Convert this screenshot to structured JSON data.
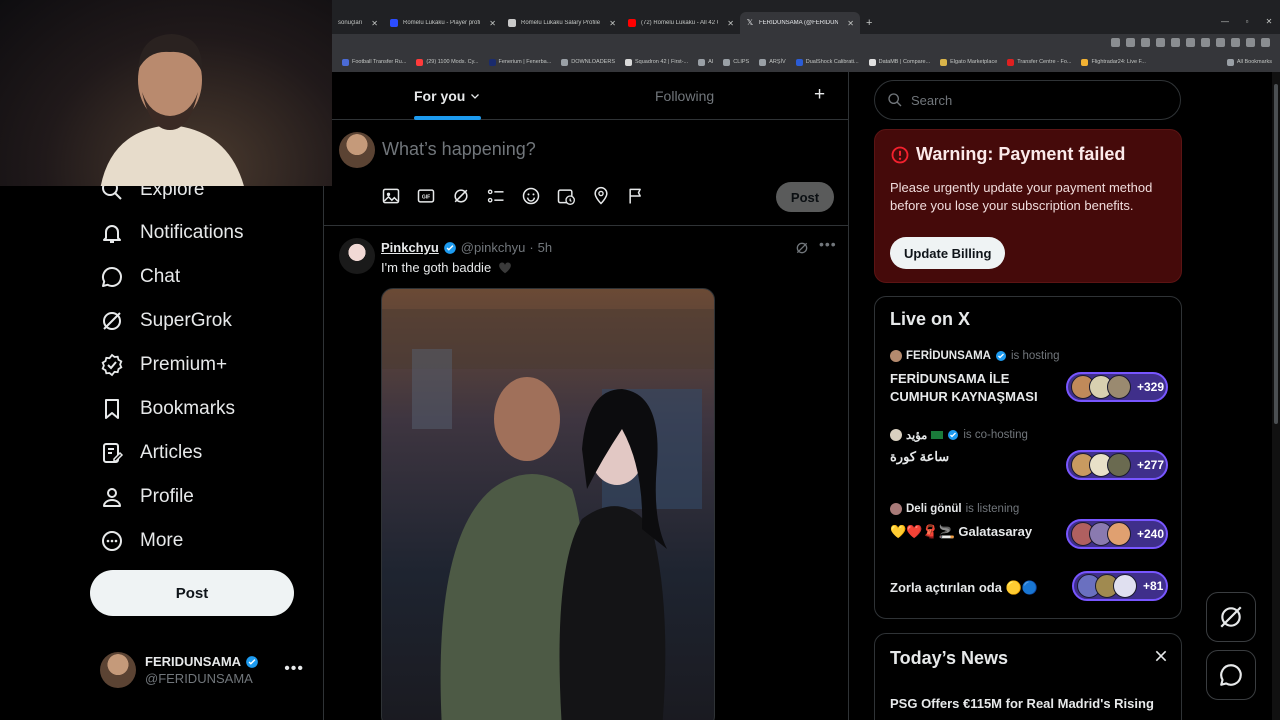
{
  "browser": {
    "tabs": [
      {
        "label": "sonuçları",
        "color": "#7aa7ff"
      },
      {
        "label": "Romelu Lukaku - Player profile",
        "color": "#2b4cff"
      },
      {
        "label": "Romelu Lukaku Salary Profile |",
        "color": "#c9c9c9"
      },
      {
        "label": "(72) Romelu Lukaku - All 42 Go",
        "color": "#ff0000"
      },
      {
        "label": "FERIDUNSAMA (@FERIDUNSAM",
        "color": "#e7e9ea"
      }
    ],
    "bookmarks": [
      {
        "label": "Football Transfer Ru...",
        "color": "#4b6bd6"
      },
      {
        "label": "(29) 1100 Mods. Cy...",
        "color": "#ff3b3b"
      },
      {
        "label": "Fenerium | Fenerba...",
        "color": "#1a2b6d"
      },
      {
        "label": "DOWNLOADERS",
        "color": "#9aa0a6"
      },
      {
        "label": "Squadron 42 | First-...",
        "color": "#d9d9d9"
      },
      {
        "label": "AI",
        "color": "#9aa0a6"
      },
      {
        "label": "CLIPS",
        "color": "#9aa0a6"
      },
      {
        "label": "ARŞİV",
        "color": "#9aa0a6"
      },
      {
        "label": "DualShock Calibrati...",
        "color": "#2b5cd6"
      },
      {
        "label": "DataMB | Compare...",
        "color": "#e0e0e0"
      },
      {
        "label": "Elgato Marketplace",
        "color": "#d9b44a"
      },
      {
        "label": "Transfer Centre - Fo...",
        "color": "#e02020"
      },
      {
        "label": "Flightradar24: Live F...",
        "color": "#f2b233"
      }
    ],
    "all_bookmarks": "All Bookmarks"
  },
  "nav": {
    "items": [
      {
        "label": "Explore",
        "icon": "search-icon"
      },
      {
        "label": "Notifications",
        "icon": "bell-icon"
      },
      {
        "label": "Chat",
        "icon": "chat-icon"
      },
      {
        "label": "SuperGrok",
        "icon": "grok-icon"
      },
      {
        "label": "Premium+",
        "icon": "verified-badge-icon"
      },
      {
        "label": "Bookmarks",
        "icon": "bookmark-icon"
      },
      {
        "label": "Articles",
        "icon": "article-icon"
      },
      {
        "label": "Profile",
        "icon": "person-icon"
      },
      {
        "label": "More",
        "icon": "more-circle-icon"
      }
    ],
    "post_label": "Post",
    "account": {
      "name": "FERIDUNSAMA",
      "handle": "@FERIDUNSAMA"
    }
  },
  "feed": {
    "tabs": {
      "for_you": "For you",
      "following": "Following"
    },
    "composer": {
      "placeholder": "What’s happening?",
      "post_label": "Post"
    },
    "tweet": {
      "name": "Pinkchyu",
      "handle": "@pinkchyu",
      "time": "5h",
      "text": "I'm the goth baddie"
    }
  },
  "sidebar": {
    "search_placeholder": "Search",
    "warning": {
      "title": "Warning: Payment failed",
      "body": "Please urgently update your payment method before you lose your subscription benefits.",
      "button": "Update Billing"
    },
    "live": {
      "title": "Live on X",
      "spaces": [
        {
          "host": "FERİDUNSAMA",
          "role": "is hosting",
          "title": "FERİDUNSAMA İLE CUMHUR KAYNAŞMASI",
          "count": "+329"
        },
        {
          "host": "مؤيد",
          "role": "is co-hosting",
          "title": "ساعة كورة",
          "count": "+277"
        },
        {
          "host": "Deli gönül",
          "role": "is listening",
          "title": "💛❤️🧣🚬 Galatasaray",
          "count": "+240"
        },
        {
          "host": "",
          "role": "",
          "title": "Zorla açtırılan oda 🟡🔵",
          "count": "+81"
        }
      ]
    },
    "news": {
      "title": "Today’s News",
      "headline": "PSG Offers €115M for Real Madrid's Rising"
    }
  },
  "colors": {
    "accent": "#1d9bf0",
    "verified": "#1d9bf0",
    "warning_bg": "#450a0a",
    "space_pill": "#7856ff"
  }
}
